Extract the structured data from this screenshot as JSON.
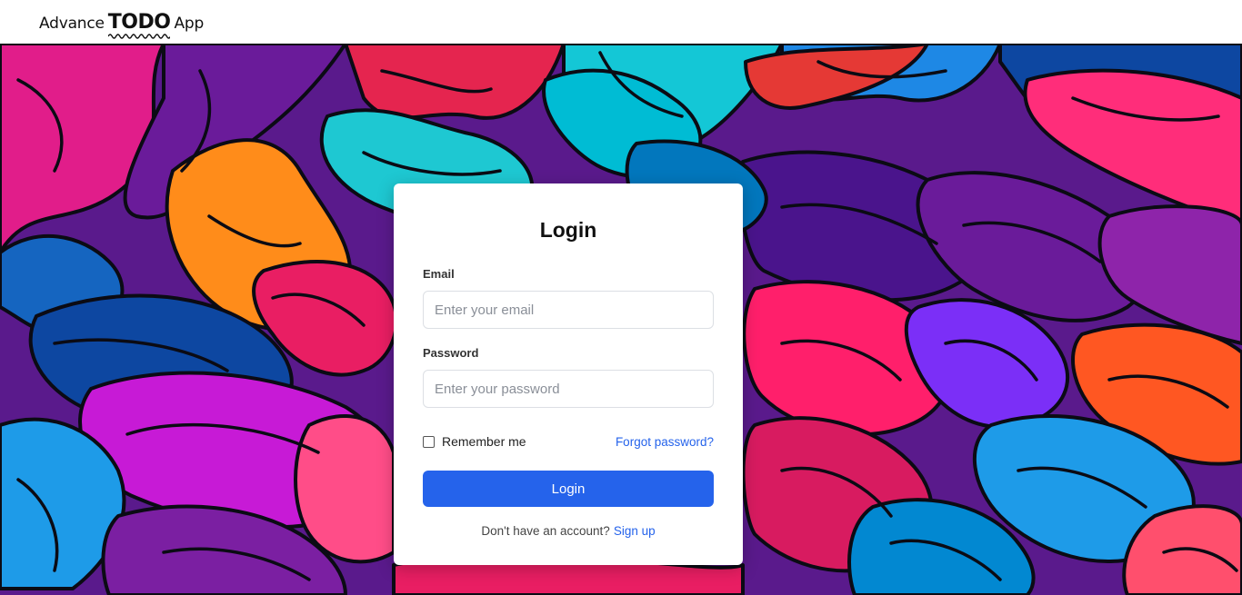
{
  "app": {
    "brand_part1": "Advance",
    "brand_part2": "TODO",
    "brand_part3": "App"
  },
  "login": {
    "title": "Login",
    "email_label": "Email",
    "email_placeholder": "Enter your email",
    "password_label": "Password",
    "password_placeholder": "Enter your password",
    "remember_label": "Remember me",
    "remember_checked": false,
    "forgot_link": "Forgot password?",
    "submit_label": "Login",
    "signup_prompt": "Don't have an account?",
    "signup_link": "Sign up"
  },
  "colors": {
    "accent": "#2563eb",
    "card": "#ffffff"
  }
}
